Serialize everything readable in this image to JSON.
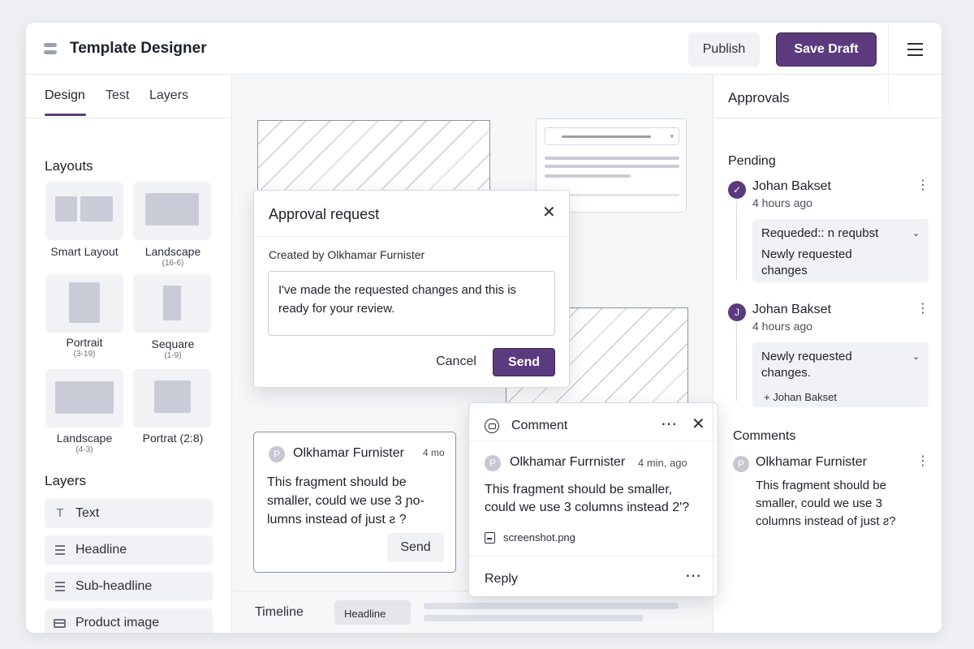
{
  "app": {
    "title": "Template Designer",
    "publish_label": "Publish",
    "save_label": "Save Draft",
    "menu_icon": "hamburger-menu-icon",
    "accent_color": "#5b3a7e"
  },
  "sidebar": {
    "tabs": [
      {
        "label": "Design",
        "active": true
      },
      {
        "label": "Test",
        "active": false
      },
      {
        "label": "Layers",
        "active": false
      }
    ],
    "layouts_heading": "Layouts",
    "layouts": [
      {
        "label": "Smart Layout",
        "sub": ""
      },
      {
        "label": "Landscape",
        "sub": "(16-6)"
      },
      {
        "label": "Portrait",
        "sub": "(3-19)"
      },
      {
        "label": "Sequare",
        "sub": "(1-9)"
      },
      {
        "label": "Landscape",
        "sub": "(4-3)"
      },
      {
        "label": "Portrat (2:8)",
        "sub": ""
      }
    ],
    "layers_heading": "Layers",
    "layers": [
      {
        "label": "Text",
        "icon": "text-icon"
      },
      {
        "label": "Headline",
        "icon": "lines-icon"
      },
      {
        "label": "Sub-headline",
        "icon": "lines-icon"
      },
      {
        "label": "Product image",
        "icon": "image-icon"
      }
    ]
  },
  "canvas": {
    "comment_card": {
      "avatar": "P",
      "author": "Olkhamar Furnister",
      "time": "4 mo",
      "text": "This fragment should  be smaller, could we use 3 ɲo-lumns instead of just ƨ ?",
      "send_label": "Send"
    },
    "timeline": {
      "label": "Timeline",
      "chip": "Headline"
    }
  },
  "modal": {
    "title": "Approval request",
    "created_by": "Created by  Olkhamar Furnister",
    "message": "I've made the requested changes  and this is ready for your review.",
    "cancel_label": "Cancel",
    "send_label": "Send"
  },
  "popover": {
    "title": "Comment",
    "avatar": "P",
    "author": "Olkhamar Furrnister",
    "time": "4 min, ago",
    "text": "This fragment should be smaller, could we use 3 columns instead 2'?",
    "attachment": "screenshot.png",
    "reply_label": "Reply"
  },
  "approvals": {
    "title": "Approvals",
    "pending_heading": "Pending",
    "items": [
      {
        "avatar": "✓",
        "name": "Johan Bakset",
        "time": "4 hours ago",
        "box_line1": "Requeded:: n requbst",
        "box_line2": "Newly requested changes"
      },
      {
        "avatar": "J",
        "name": "Johan Bakset",
        "time": "4 hours ago",
        "box_line1": "Newly requested changes.",
        "add_label": "Johan Bakset"
      }
    ],
    "comments_heading": "Comments",
    "comment": {
      "avatar": "P",
      "author": "Olkhamar Furnister",
      "text": "This fragment should be smaller, could we use 3 columns instead of just ƨ?"
    }
  }
}
